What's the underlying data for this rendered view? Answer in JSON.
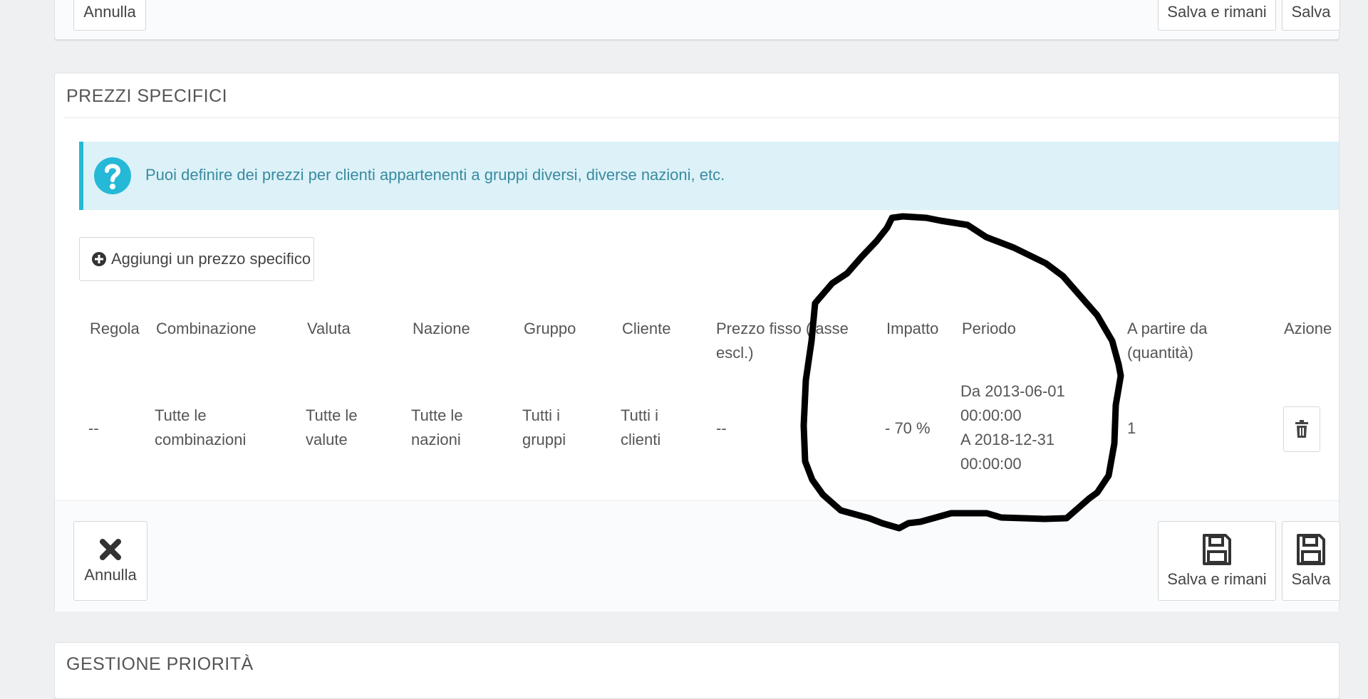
{
  "top_panel": {
    "cancel_label": "Annulla",
    "save_stay_label": "Salva e rimani",
    "save_label": "Salva"
  },
  "specific_prices": {
    "heading": "PREZZI SPECIFICI",
    "alert_text": "Puoi definire dei prezzi per clienti appartenenti a gruppi diversi, diverse nazioni, etc.",
    "alert_icon": "question-circle-icon",
    "add_button_label": "Aggiungi un prezzo specifico",
    "add_button_icon": "plus-circle-icon",
    "table": {
      "headers": [
        {
          "line1": "Regola",
          "line2": ""
        },
        {
          "line1": "Combinazione",
          "line2": ""
        },
        {
          "line1": "Valuta",
          "line2": ""
        },
        {
          "line1": "Nazione",
          "line2": ""
        },
        {
          "line1": "Gruppo",
          "line2": ""
        },
        {
          "line1": "Cliente",
          "line2": ""
        },
        {
          "line1": "Prezzo fisso (tasse",
          "line2": "escl.)"
        },
        {
          "line1": "Impatto",
          "line2": ""
        },
        {
          "line1": "Periodo",
          "line2": ""
        },
        {
          "line1": "A partire da",
          "line2": "(quantità)"
        },
        {
          "line1": "Azione",
          "line2": ""
        }
      ],
      "rows": [
        {
          "rule": "--",
          "combination": [
            "Tutte le",
            "combinazioni"
          ],
          "currency": [
            "Tutte le",
            "valute"
          ],
          "country": [
            "Tutte le",
            "nazioni"
          ],
          "group": [
            "Tutti i",
            "gruppi"
          ],
          "customer": [
            "Tutti i",
            "clienti"
          ],
          "fixed_price": "--",
          "impact": "- 70 %",
          "period": [
            "Da 2013-06-01",
            "00:00:00",
            "A 2018-12-31",
            "00:00:00"
          ],
          "from_quantity": "1",
          "action_icon": "trash-icon"
        }
      ]
    },
    "footer": {
      "cancel_label": "Annulla",
      "cancel_icon": "close-icon",
      "save_stay_label": "Salva e rimani",
      "save_stay_icon": "floppy-disk-icon",
      "save_label": "Salva",
      "save_icon": "floppy-disk-icon"
    }
  },
  "priority_panel": {
    "heading": "GESTIONE PRIORITÀ"
  },
  "colors": {
    "page_background": "#eef0f2",
    "alert_background": "#dcf2f8",
    "alert_accent": "#25b9d7",
    "annotation_stroke": "#000000"
  }
}
